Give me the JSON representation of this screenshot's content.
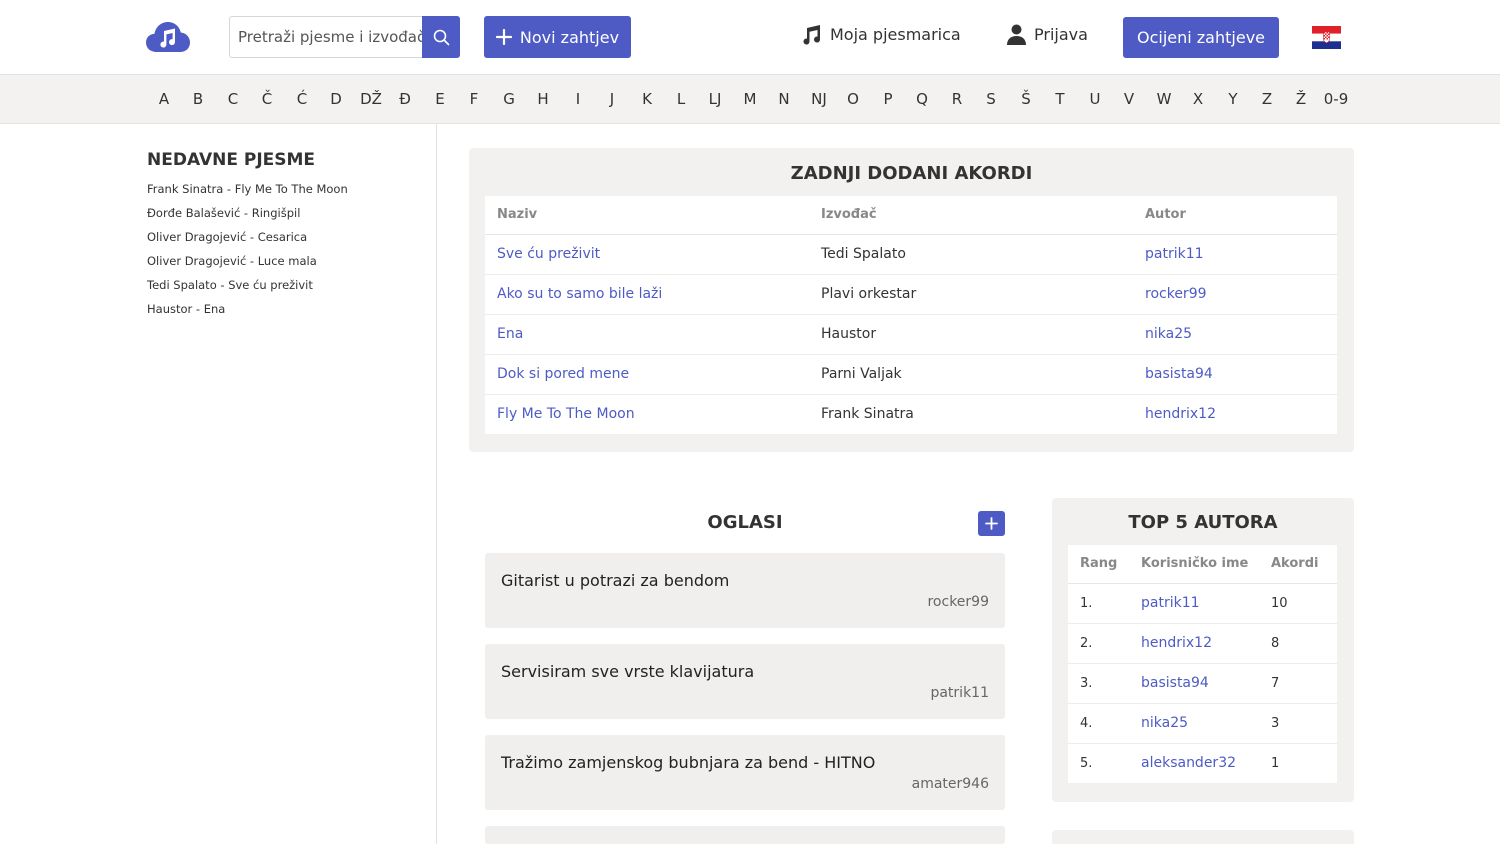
{
  "header": {
    "search_placeholder": "Pretraži pjesme i izvođače",
    "new_request_label": "Novi zahtjev",
    "songbook_label": "Moja pjesmarica",
    "login_label": "Prijava",
    "rate_requests_label": "Ocijeni zahtjeve",
    "flag": "croatian-flag-icon",
    "accent_color": "#4e5bc4"
  },
  "alphabet": [
    "A",
    "B",
    "C",
    "Č",
    "Ć",
    "D",
    "DŽ",
    "Đ",
    "E",
    "F",
    "G",
    "H",
    "I",
    "J",
    "K",
    "L",
    "LJ",
    "M",
    "N",
    "NJ",
    "O",
    "P",
    "Q",
    "R",
    "S",
    "Š",
    "T",
    "U",
    "V",
    "W",
    "X",
    "Y",
    "Z",
    "Ž",
    "0-9"
  ],
  "sidebar": {
    "title": "NEDAVNE PJESME",
    "items": [
      "Frank Sinatra - Fly Me To The Moon",
      "Đorđe Balašević - Ringišpil",
      "Oliver Dragojević - Cesarica",
      "Oliver Dragojević - Luce mala",
      "Tedi Spalato - Sve ću preživit",
      "Haustor - Ena"
    ]
  },
  "latest_chords": {
    "title": "ZADNJI DODANI AKORDI",
    "columns": [
      "Naziv",
      "Izvođač",
      "Autor"
    ],
    "rows": [
      [
        "Sve ću preživit",
        "Tedi Spalato",
        "patrik11"
      ],
      [
        "Ako su to samo bile laži",
        "Plavi orkestar",
        "rocker99"
      ],
      [
        "Ena",
        "Haustor",
        "nika25"
      ],
      [
        "Dok si pored mene",
        "Parni Valjak",
        "basista94"
      ],
      [
        "Fly Me To The Moon",
        "Frank Sinatra",
        "hendrix12"
      ]
    ]
  },
  "ads": {
    "title": "OGLASI",
    "items": [
      {
        "title": "Gitarist u potrazi za bendom",
        "user": "rocker99"
      },
      {
        "title": "Servisiram sve vrste klavijatura",
        "user": "patrik11"
      },
      {
        "title": "Tražimo zamjenskog bubnjara za bend - HITNO",
        "user": "amater946"
      }
    ]
  },
  "top_authors": {
    "title": "TOP 5 AUTORA",
    "columns": [
      "Rang",
      "Korisničko ime",
      "Akordi"
    ],
    "rows": [
      [
        "1.",
        "patrik11",
        "10"
      ],
      [
        "2.",
        "hendrix12",
        "8"
      ],
      [
        "3.",
        "basista94",
        "7"
      ],
      [
        "4.",
        "nika25",
        "3"
      ],
      [
        "5.",
        "aleksander32",
        "1"
      ]
    ]
  }
}
